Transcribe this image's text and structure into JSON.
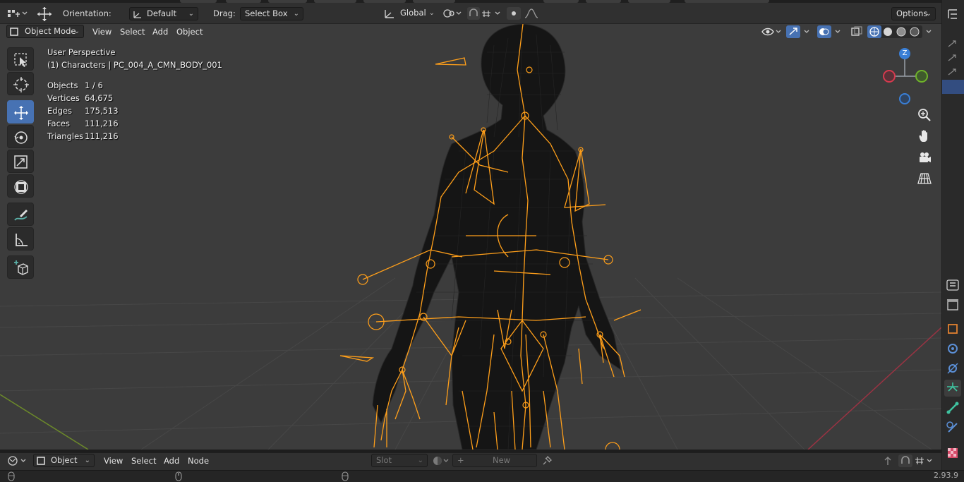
{
  "header": {
    "orientation_label": "Orientation:",
    "orientation_value": "Default",
    "drag_label": "Drag:",
    "drag_value": "Select Box",
    "transform_orientation": "Global",
    "options_label": "Options"
  },
  "viewport_header": {
    "mode": "Object Mode",
    "menus": [
      "View",
      "Select",
      "Add",
      "Object"
    ]
  },
  "overlay": {
    "perspective": "User Perspective",
    "active_object": "(1) Characters | PC_004_A_CMN_BODY_001",
    "stats": [
      {
        "label": "Objects",
        "value": "1 / 6"
      },
      {
        "label": "Vertices",
        "value": "64,675"
      },
      {
        "label": "Edges",
        "value": "175,513"
      },
      {
        "label": "Faces",
        "value": "111,216"
      },
      {
        "label": "Triangles",
        "value": "111,216"
      }
    ]
  },
  "gizmo": {
    "z_label": "Z",
    "colors": {
      "x": "#d63a4e",
      "y": "#6fb32a",
      "z": "#3a7fd6"
    }
  },
  "toolbar": {
    "tools": [
      "select-box-icon",
      "cursor-icon",
      "move-icon",
      "rotate-icon",
      "scale-icon",
      "transform-icon",
      "annotate-icon",
      "measure-icon",
      "add-cube-icon"
    ],
    "active": "move-icon"
  },
  "node_header": {
    "editor_type": "Object",
    "menus": [
      "View",
      "Select",
      "Add",
      "Node"
    ],
    "slot_label": "Slot",
    "new_label": "New"
  },
  "status": {
    "version": "2.93.9"
  },
  "colors": {
    "accent": "#4772b3",
    "bone": "#ff9f1a",
    "viewport_bg": "#3c3c3c"
  }
}
